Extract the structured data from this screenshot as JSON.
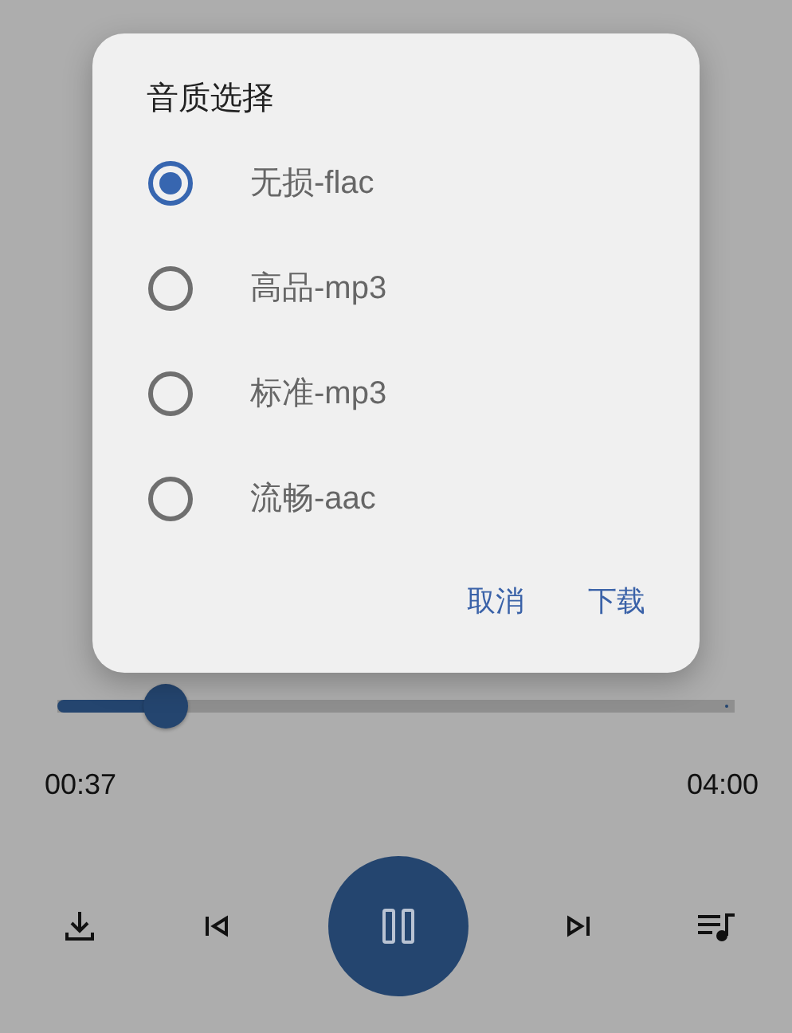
{
  "dialog": {
    "title": "音质选择",
    "options": [
      {
        "label": "无损-flac",
        "selected": true
      },
      {
        "label": "高品-mp3",
        "selected": false
      },
      {
        "label": "标准-mp3",
        "selected": false
      },
      {
        "label": "流畅-aac",
        "selected": false
      }
    ],
    "buttons": [
      "取消",
      "下载"
    ]
  },
  "player": {
    "progress": {
      "level": 0.16
    },
    "elapsed": "00:37",
    "duration": "04:00",
    "playing": true
  }
}
